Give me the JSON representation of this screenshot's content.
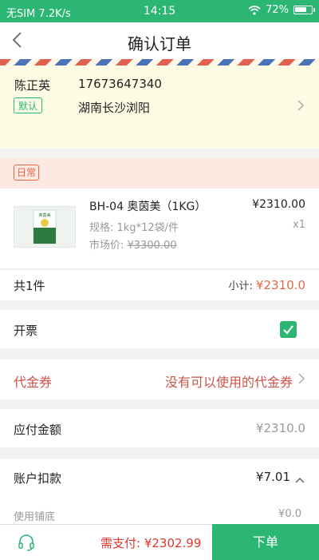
{
  "status_bar": {
    "carrier": "无SIM 7.2K/s",
    "time": "14:15",
    "battery": "72%",
    "battery_level": 0.72
  },
  "nav": {
    "title": "确认订单"
  },
  "address": {
    "name": "陈正英",
    "phone": "17673647340",
    "default_tag": "默认",
    "location": "湖南长沙浏阳"
  },
  "shop": {
    "tag": "日常"
  },
  "product": {
    "name": "BH-04 奥茵美（1KG）",
    "price": "¥2310.00",
    "spec": "规格: 1kg*12袋/件",
    "quantity": "x1",
    "market_label": "市场价: ",
    "market_price": "¥3300.00",
    "thumb_text": "奥茵美"
  },
  "summary": {
    "count": "共1件",
    "subtotal_label": "小计: ",
    "subtotal": "¥2310.0"
  },
  "invoice": {
    "label": "开票",
    "checked": true
  },
  "coupon": {
    "label": "代金券",
    "status": "没有可以使用的代金券"
  },
  "payable": {
    "label": "应付金额",
    "amount": "¥2310.0"
  },
  "deduction": {
    "label": "账户扣款",
    "amount": "¥7.01"
  },
  "pu_di": {
    "label": "使用铺底",
    "amount": "¥0.0"
  },
  "bottom": {
    "need_pay": "需支付: ¥2302.99",
    "submit": "下单"
  },
  "colors": {
    "accent": "#2bb673",
    "price_red": "#e0362c",
    "coupon_red": "#c9544a",
    "tag_orange": "#e2684a"
  }
}
